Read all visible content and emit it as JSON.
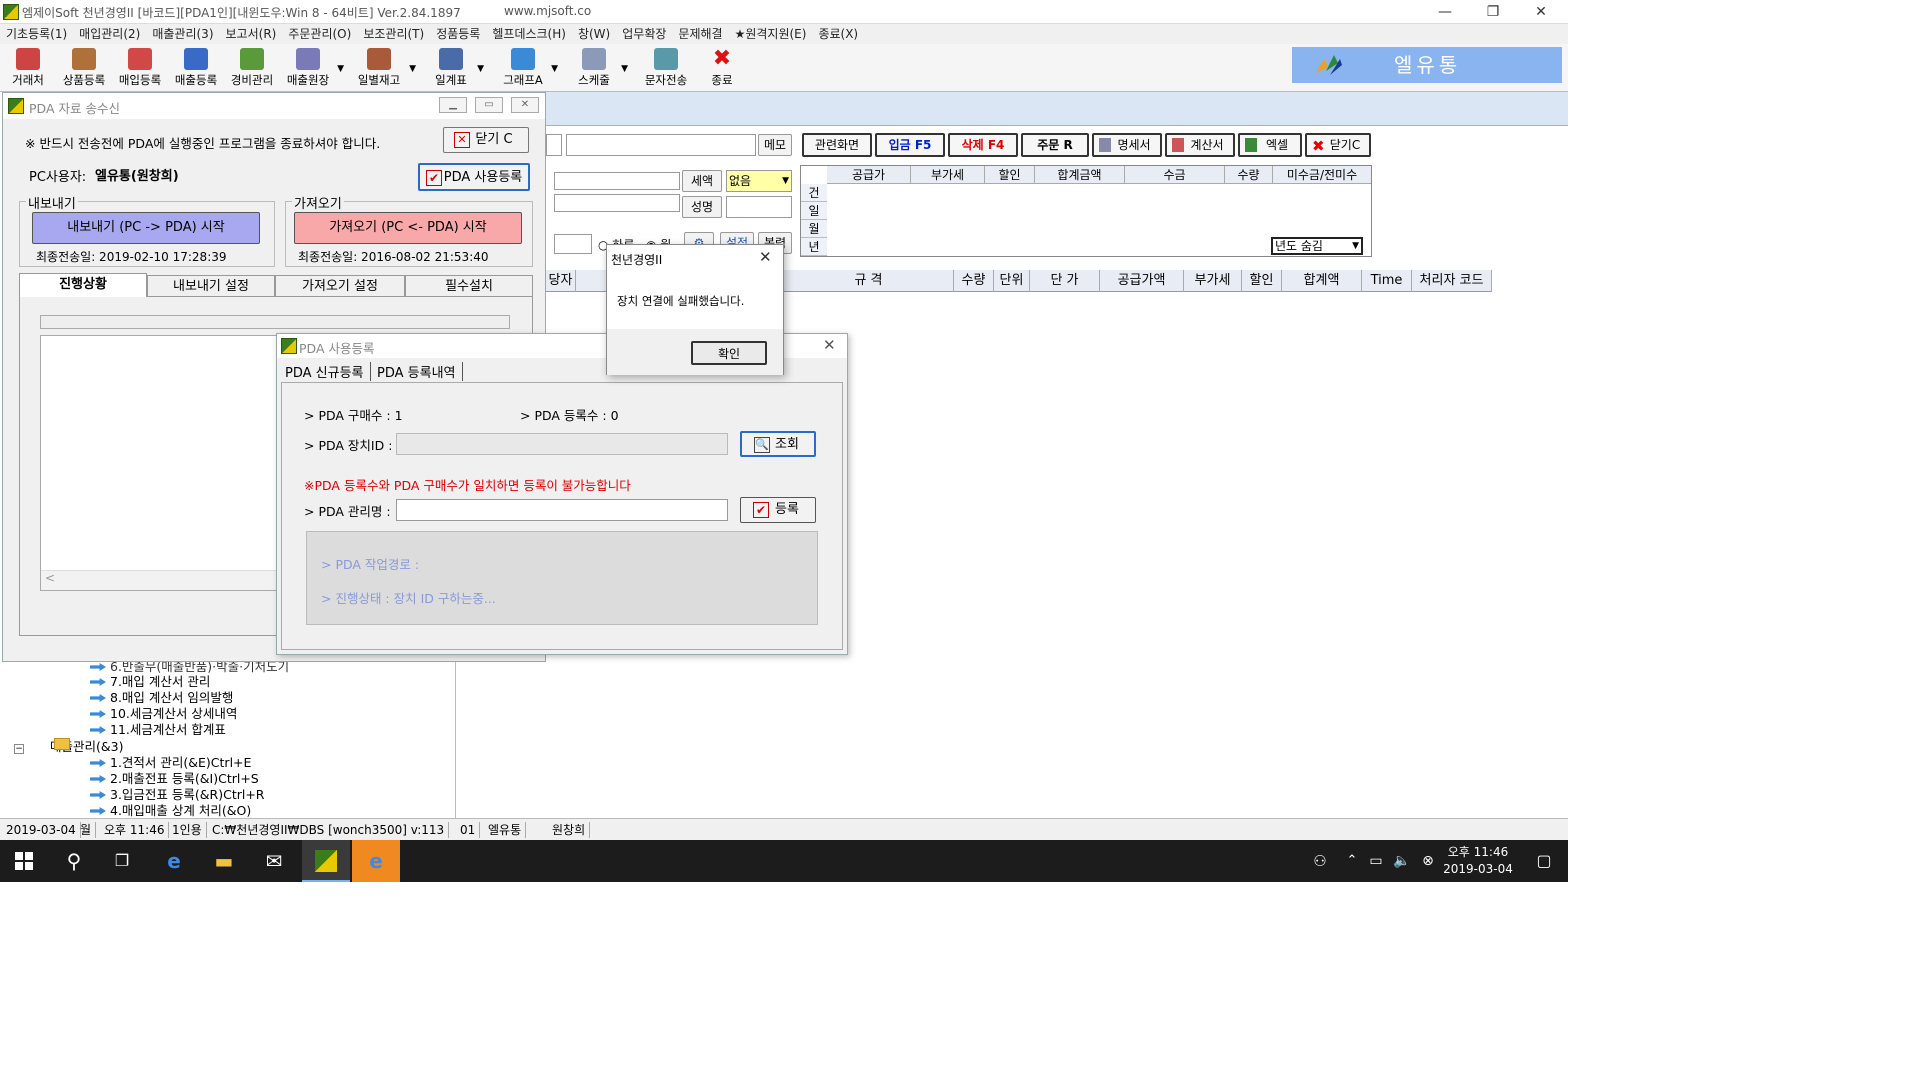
{
  "window": {
    "title": "엠제이Soft 천년경영II [바코드][PDA1인][내윈도우:Win 8 - 64비트] Ver.2.84.1897",
    "url": "www.mjsoft.co",
    "minimize": "—",
    "restore": "❐",
    "close": "✕"
  },
  "menu": [
    "기초등록(1)",
    "매입관리(2)",
    "매출관리(3)",
    "보고서(R)",
    "주문관리(O)",
    "보조관리(T)",
    "정품등록",
    "헬프데스크(H)",
    "창(W)",
    "업무확장",
    "문제해결",
    "★원격지원(E)",
    "종료(X)"
  ],
  "toolbar": [
    "거래처",
    "상품등록",
    "매입등록",
    "매출등록",
    "경비관리",
    "매출원장",
    "일별재고",
    "일계표",
    "그래프A",
    "스케줄",
    "문자전송",
    "종료"
  ],
  "brand": {
    "text": "엘유통",
    "color": "#8ab4f0"
  },
  "main": {
    "memo_label": "메모",
    "buttons": [
      "관련화면",
      "입금 F5",
      "삭제 F4",
      "주문 R",
      "명세서",
      "계산서",
      "엑셀",
      "닫기C"
    ],
    "vat_label": "세액",
    "vat_value": "없음",
    "name_label": "성명",
    "radio_day": "하루",
    "radio_month": "월",
    "btn_settings": "설정",
    "btn_print": "복력",
    "top_grid_headers": [
      "공급가",
      "부가세",
      "할인",
      "합계금액",
      "수금",
      "수량",
      "미수금/전미수"
    ],
    "row_labels": [
      "건",
      "일",
      "월",
      "년"
    ],
    "year_select": "년도 숨김",
    "grid_headers": [
      "당자",
      "규 격",
      "수량",
      "단위",
      "단 가",
      "공급가액",
      "부가세",
      "할인",
      "합계액",
      "Time",
      "처리자 코드"
    ]
  },
  "pda_window": {
    "title": "PDA 자료 송수신",
    "warning": "※ 반드시 전송전에 PDA에 실행중인 프로그램을 종료하셔야 합니다.",
    "close_button": "닫기 C",
    "user_label": "PC사용자:",
    "user_value": "엘유통(원창희)",
    "register_button": "PDA 사용등록",
    "export_group": "내보내기",
    "export_button": "내보내기 (PC -> PDA) 시작",
    "export_last": "최종전송일: 2019-02-10 17:28:39",
    "import_group": "가져오기",
    "import_button": "가져오기 (PC <- PDA) 시작",
    "import_last": "최종전송일: 2016-08-02 21:53:40",
    "tabs": [
      "진행상황",
      "내보내기 설정",
      "가져오기 설정",
      "필수설치"
    ]
  },
  "tree": {
    "partial": "6.반출무(매출반품)·박출·기처도기",
    "items": [
      "7.매입 계산서 관리",
      "8.매입 계산서 임의발행",
      "10.세금계산서 상세내역",
      "11.세금계산서 합계표"
    ],
    "folder": "매출관리(&3)",
    "folder_items": [
      "1.견적서 관리(&E)Ctrl+E",
      "2.매출전표 등록(&I)Ctrl+S",
      "3.입금전표 등록(&R)Ctrl+R",
      "4.매입매출 상계 처리(&O)"
    ]
  },
  "reg_window": {
    "title": "PDA 사용등록",
    "tabs": [
      "PDA 신규등록",
      "PDA 등록내역"
    ],
    "purchase_count": "> PDA 구매수 : 1",
    "register_count": "> PDA 등록수 : 0",
    "device_id_label": "> PDA 장치ID :",
    "device_id_value": "",
    "search_button": "조회",
    "notice": "※PDA 등록수와 PDA 구매수가 일치하면 등록이 불가능합니다",
    "manager_label": "> PDA 관리명 :",
    "manager_value": "",
    "register_button": "등록",
    "work_path": "> PDA 작업경로 :",
    "progress": "> 진행상태 : 장치 ID 구하는중..."
  },
  "msgbox": {
    "title": "천년경영II",
    "message": "장치 연결에 실패했습니다.",
    "ok": "확인"
  },
  "statusbar": [
    "2019-03-04",
    "월",
    "오후 11:46",
    "1인용",
    "C:₩천년경영II₩DBS [wonch3500] v:113",
    "01",
    "엘유통",
    "원창희"
  ],
  "taskbar": {
    "time": "오후 11:46",
    "date": "2019-03-04"
  }
}
